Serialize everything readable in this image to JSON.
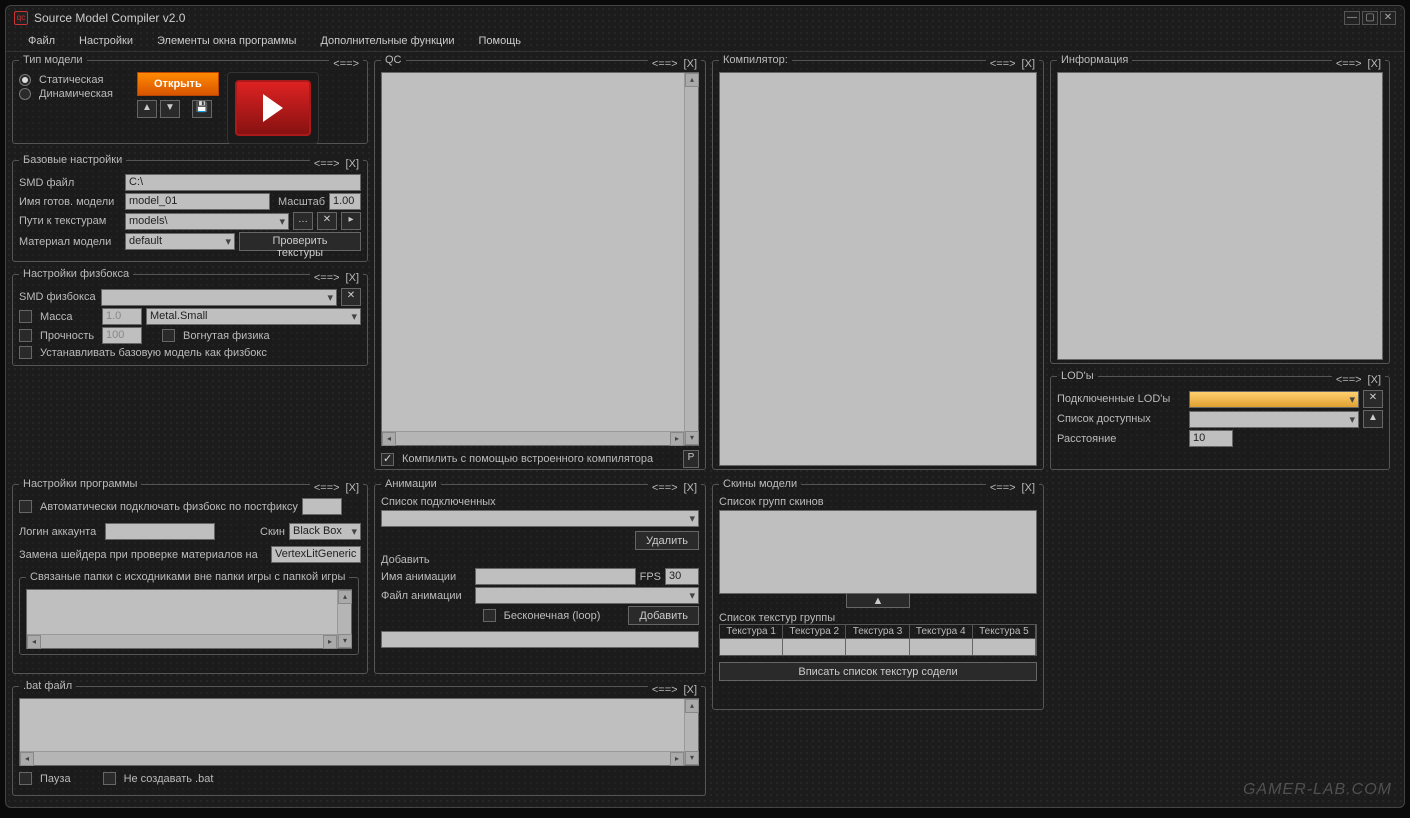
{
  "window": {
    "title": "Source Model Compiler v2.0"
  },
  "menu": {
    "file": "Файл",
    "settings": "Настройки",
    "elements": "Элементы окна программы",
    "extra": "Дополнительные функции",
    "help": "Помощь"
  },
  "model_type": {
    "legend": "Тип модели",
    "static": "Статическая",
    "dynamic": "Динамическая",
    "open": "Открыть"
  },
  "base_settings": {
    "legend": "Базовые настройки",
    "smd_file": "SMD файл",
    "smd_file_val": "C:\\",
    "model_name": "Имя готов. модели",
    "model_name_val": "model_01",
    "scale": "Масштаб",
    "scale_val": "1.00",
    "tex_paths": "Пути к текстурам",
    "tex_paths_val": "models\\",
    "mat_model": "Материал модели",
    "mat_model_val": "default",
    "check_tex": "Проверить текстуры"
  },
  "physbox": {
    "legend": "Настройки физбокса",
    "smd": "SMD физбокса",
    "mass": "Масса",
    "mass_val": "1.0",
    "surface": "Metal.Small",
    "strength": "Прочность",
    "strength_val": "100",
    "concave": "Вогнутая физика",
    "set_base": "Устанавливать базовую модель как физбокс"
  },
  "prog_settings": {
    "legend": "Настройки программы",
    "auto_physbox": "Автоматически подключать физбокс по постфиксу",
    "login": "Логин аккаунта",
    "skin": "Скин",
    "skin_val": "Black Box",
    "shader_replace": "Замена шейдера при проверке материалов на",
    "shader_val": "VertexLitGeneric",
    "linked_folders": "Связаные папки с исходниками вне папки игры с папкой игры"
  },
  "bat": {
    "legend": ".bat файл",
    "pause": "Пауза",
    "no_create": "Не создавать .bat"
  },
  "qc": {
    "legend": "QC",
    "builtin": "Компилить с помощью встроенного компилятора"
  },
  "anim": {
    "legend": "Анимации",
    "list": "Список подключенных",
    "delete": "Удалить",
    "add_header": "Добавить",
    "name": "Имя анимации",
    "fps": "FPS",
    "fps_val": "30",
    "file": "Файл анимации",
    "loop": "Бесконечная (loop)",
    "add": "Добавить"
  },
  "compiler": {
    "legend": "Компилятор:"
  },
  "skins": {
    "legend": "Скины модели",
    "groups": "Список групп скинов",
    "textures": "Список текстур группы",
    "tex1": "Текстура 1",
    "tex2": "Текстура 2",
    "tex3": "Текстура 3",
    "tex4": "Текстура 4",
    "tex5": "Текстура 5",
    "write": "Вписать список текстур содели"
  },
  "info": {
    "legend": "Информация"
  },
  "lod": {
    "legend": "LOD'ы",
    "connected": "Подключенные LOD'ы",
    "available": "Список доступных",
    "distance": "Расстояние",
    "distance_val": "10"
  },
  "watermark": "GAMER-LAB.COM"
}
